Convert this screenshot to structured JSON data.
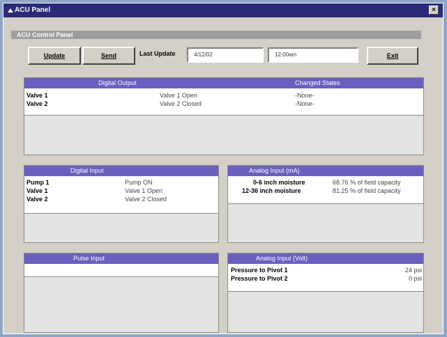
{
  "window": {
    "title": "ACU Panel",
    "close": "×"
  },
  "panel_bar": "ACU Control Panel",
  "toolbar": {
    "update": "Update",
    "send": "Send",
    "last_update_label": "Last Update",
    "date": "4/12/02",
    "time": "12:00am",
    "exit": "Exit"
  },
  "digital_output": {
    "headers": {
      "title": "Digital Output",
      "changed": "Changed States"
    },
    "rows": [
      {
        "name": "Valve 1",
        "state": "Valve 1 Open",
        "changed": "-None-"
      },
      {
        "name": "Valve 2",
        "state": "Valve 2 Closed",
        "changed": "-None-"
      }
    ]
  },
  "digital_input": {
    "title": "Digital Input",
    "rows": [
      {
        "name": "Pump 1",
        "state": "Pump ON"
      },
      {
        "name": "Valve 1",
        "state": "Valve 1 Open"
      },
      {
        "name": "Valve 2",
        "state": "Valve 2 Closed"
      }
    ]
  },
  "analog_ma": {
    "title": "Analog Input (mA)",
    "rows": [
      {
        "name": "0-6 inch moisture",
        "value": "68.76 % of field capacity"
      },
      {
        "name": "12-36 inch moisture",
        "value": "81.25 % of field capacity"
      }
    ]
  },
  "pulse_input": {
    "title": "Pulse Input"
  },
  "analog_volt": {
    "title": "Analog Input (Volt)",
    "rows": [
      {
        "name": "Pressure to Pivot 1",
        "value": "24 psi"
      },
      {
        "name": "Pressure to Pivot 2",
        "value": "0 psi"
      }
    ]
  }
}
